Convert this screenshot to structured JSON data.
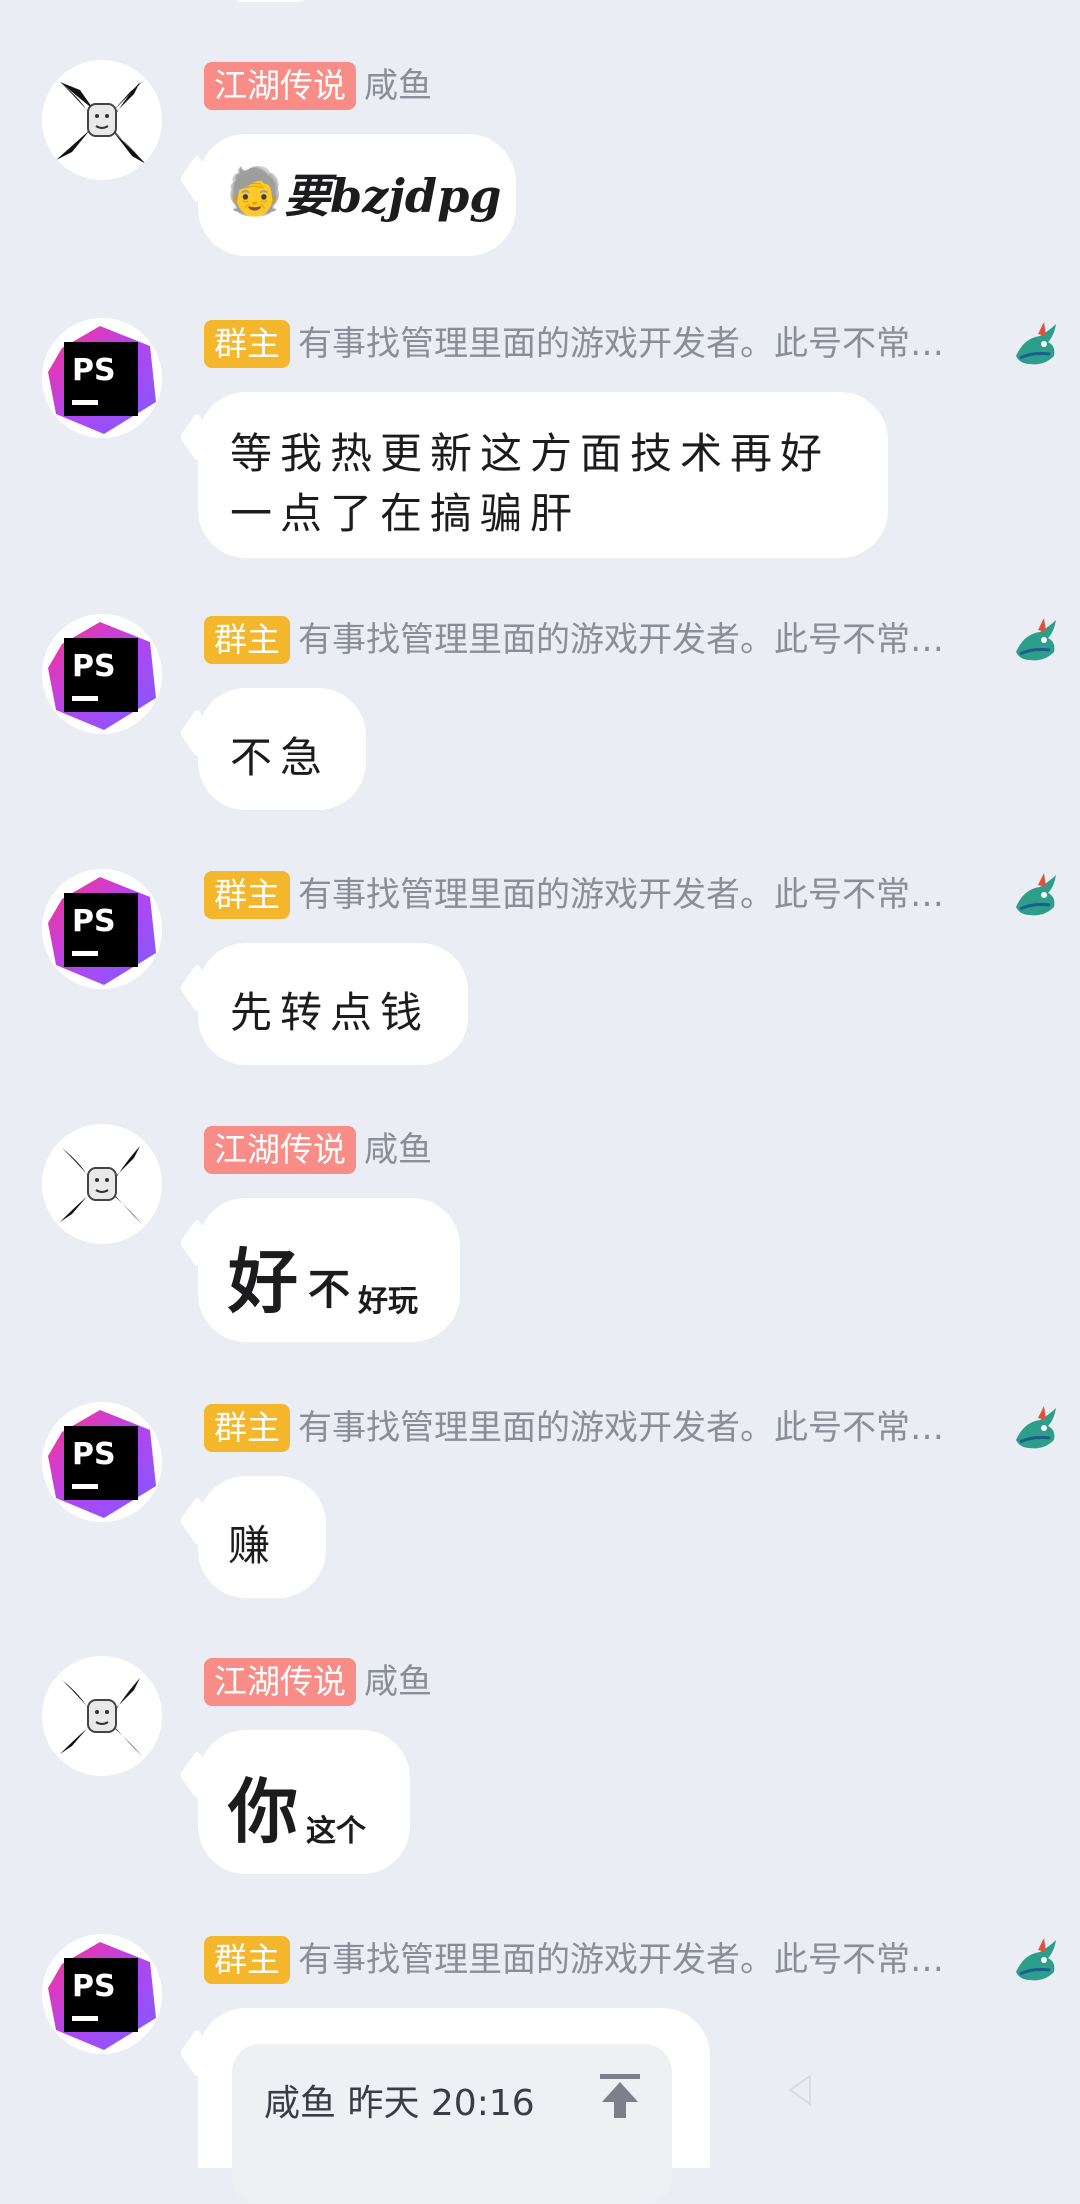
{
  "messages": [
    {
      "role": "jianghu",
      "tag": "江湖传说",
      "sender": "咸鱼",
      "emoji": "🧓",
      "text": "要bzjdpg"
    },
    {
      "role": "owner",
      "tag": "群主",
      "sender": "有事找管理里面的游戏开发者。此号不常…",
      "text_line1": "等我热更新这方面技术再好",
      "text_line2": "一点了在搞骗肝"
    },
    {
      "role": "owner",
      "tag": "群主",
      "sender": "有事找管理里面的游戏开发者。此号不常…",
      "text": "不急"
    },
    {
      "role": "owner",
      "tag": "群主",
      "sender": "有事找管理里面的游戏开发者。此号不常…",
      "text": "先转点钱"
    },
    {
      "role": "jianghu",
      "tag": "江湖传说",
      "sender": "咸鱼",
      "text_big": "好",
      "text_mid": "不",
      "text_small": "好玩"
    },
    {
      "role": "owner",
      "tag": "群主",
      "sender": "有事找管理里面的游戏开发者。此号不常…",
      "text": "赚"
    },
    {
      "role": "jianghu",
      "tag": "江湖传说",
      "sender": "咸鱼",
      "text_big": "你",
      "text_small": "这个"
    },
    {
      "role": "owner",
      "tag": "群主",
      "sender": "有事找管理里面的游戏开发者。此号不常…",
      "quote": "咸鱼 昨天 20:16"
    }
  ],
  "icons": {
    "ps_avatar": "ps-logo-icon",
    "meme_avatar": "meme-face-icon",
    "badge": "dragon-badge-icon",
    "pin": "pin-top-icon"
  },
  "colors": {
    "background": "#eaedf4",
    "tag_jianghu": "#f88c86",
    "tag_owner": "#f4b62a",
    "sender_gray": "#8b8e98"
  }
}
